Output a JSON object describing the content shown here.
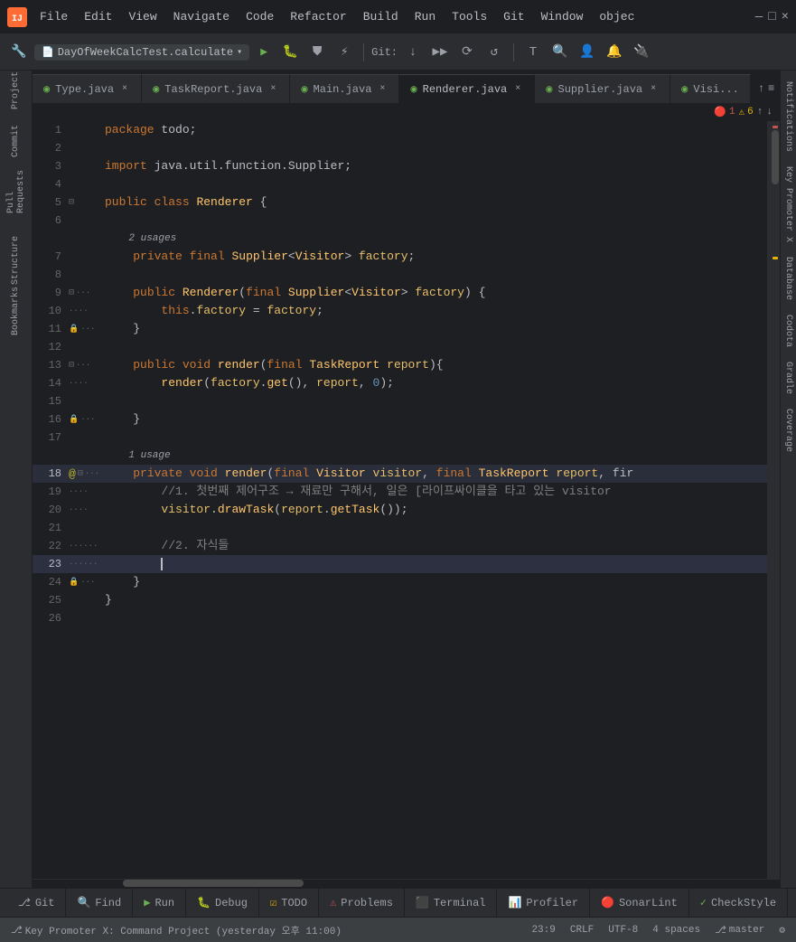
{
  "titlebar": {
    "logo": "IJ",
    "menus": [
      "File",
      "Edit",
      "View",
      "Navigate",
      "Code",
      "Refactor",
      "Build",
      "Run",
      "Tools",
      "Git",
      "Window",
      "⊞",
      "objec",
      "—",
      "□",
      "×"
    ]
  },
  "toolbar": {
    "run_config": "DayOfWeekCalcTest.calculate",
    "git_label": "Git:",
    "icons": [
      "🔧",
      "▶",
      "🔴",
      "⟳",
      "⚡",
      "🌐",
      "↓",
      "▶▶",
      "🐛",
      "⏸",
      "↺",
      "T",
      "🔍",
      "👤",
      "🔔"
    ]
  },
  "tabs": [
    {
      "label": "Type.java",
      "color": "#6aaf50",
      "active": false
    },
    {
      "label": "TaskReport.java",
      "color": "#6aaf50",
      "active": false
    },
    {
      "label": "Main.java",
      "color": "#6aaf50",
      "active": false
    },
    {
      "label": "Renderer.java",
      "color": "#6aaf50",
      "active": true
    },
    {
      "label": "Supplier.java",
      "color": "#6aaf50",
      "active": false
    },
    {
      "label": "Visi...",
      "color": "#6aaf50",
      "active": false
    }
  ],
  "error_indicator": {
    "errors": "1",
    "warnings": "6",
    "up_arrow": "↑",
    "down_arrow": "↓"
  },
  "code": {
    "package": "package todo;",
    "import": "import java.util.function.Supplier;",
    "class_decl": "public class Renderer {",
    "usages_2": "2 usages",
    "field": "    private final Supplier<Visitor> factory;",
    "usages_1": "1 usage",
    "constructor": "    public Renderer(final Supplier<Visitor> factory) {",
    "this_factory": "        this.factory = factory;",
    "close1": "    }",
    "render_method": "    public void render(final TaskReport report){",
    "render_call": "        render(factory.get(), report, 0);",
    "close2": "    }",
    "private_render": "    private void render(final Visitor visitor, final TaskReport report, fir",
    "comment1": "        //1. 첫번째 제어구조 → 재료만 구해서, 일은 [라이프싸이클을 타고 있는 visitor",
    "visitor_draw": "        visitor.drawTask(report.getTask());",
    "comment2": "        //2. 자식들",
    "cursor_line": "        ",
    "close3": "    }",
    "close4": "}"
  },
  "line_numbers": [
    1,
    2,
    3,
    4,
    5,
    6,
    7,
    8,
    9,
    10,
    11,
    12,
    13,
    14,
    15,
    16,
    17,
    18,
    19,
    20,
    21,
    22,
    23,
    24,
    25,
    26
  ],
  "right_sidebar": {
    "panels": [
      "Notifications",
      "Key Promoter X",
      "Database",
      "Codota",
      "Gradle",
      "Coverage"
    ]
  },
  "left_sidebar": {
    "panels": [
      "Project",
      "Commit",
      "Pull Requests",
      "",
      "Structure",
      "Bookmarks"
    ]
  },
  "bottom_tabs": [
    {
      "label": "Git",
      "icon": "⎇"
    },
    {
      "label": "Find",
      "icon": "🔍"
    },
    {
      "label": "Run",
      "icon": "▶"
    },
    {
      "label": "Debug",
      "icon": "🐛"
    },
    {
      "label": "TODO",
      "icon": "☑"
    },
    {
      "label": "Problems",
      "icon": "⚠"
    },
    {
      "label": "Terminal",
      "icon": "⬛"
    },
    {
      "label": "Profiler",
      "icon": "📊"
    },
    {
      "label": "SonarLint",
      "icon": "🔴"
    },
    {
      "label": "CheckStyle",
      "icon": "✓"
    }
  ],
  "status_bar": {
    "git_branch": "Key Promoter X: Command Project (yesterday 오후 11:00)",
    "position": "23:9",
    "encoding": "CRLF",
    "charset": "UTF-8",
    "indent": "4 spaces",
    "branch": "master",
    "branch_icon": "⎇"
  }
}
